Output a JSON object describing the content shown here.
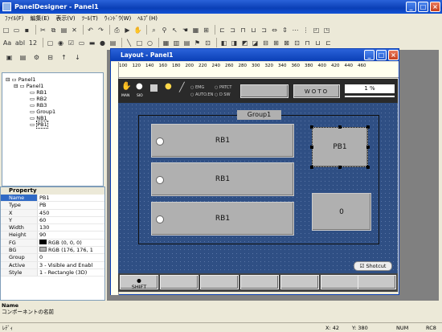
{
  "app": {
    "title": "PanelDesigner - Panel1"
  },
  "menu": [
    "ﾌｧｲﾙ(F)",
    "編集(E)",
    "表示(V)",
    "ﾂｰﾙ(T)",
    "ｳｨﾝﾄﾞｳ(W)",
    "ﾍﾙﾌﾟ(H)"
  ],
  "tree": {
    "root": "Panel1",
    "panel": "Panel1",
    "items": [
      "RB1",
      "RB2",
      "RB3",
      "Group1",
      "NB1",
      "PB1"
    ]
  },
  "props": {
    "header": "Property",
    "rows": [
      {
        "k": "Name",
        "v": "PB1"
      },
      {
        "k": "Type",
        "v": "PB"
      },
      {
        "k": "X",
        "v": "450"
      },
      {
        "k": "Y",
        "v": "60"
      },
      {
        "k": "Width",
        "v": "130"
      },
      {
        "k": "Height",
        "v": "90"
      },
      {
        "k": "FG",
        "v": "RGB (0, 0, 0)"
      },
      {
        "k": "BG",
        "v": "RGB (176, 176, 1"
      },
      {
        "k": "Group",
        "v": "0"
      },
      {
        "k": "Active",
        "v": "3 - Visible and Enabl"
      },
      {
        "k": "Style",
        "v": "1 - Rectangle (3D)"
      }
    ],
    "desc_title": "Name",
    "desc": "コンポーネントの名前"
  },
  "layout": {
    "title": "Layout - Panel1",
    "wotd": "WOTO",
    "percent": "1 %",
    "group": "Group1",
    "rb1": "RB1",
    "rb2": "RB1",
    "rb3": "RB1",
    "pb": "PB1",
    "nb": "0",
    "shotcut": "Shotcut",
    "shift": "SHIFT",
    "icons": {
      "man": "MAN",
      "sio": "SIO",
      "emg": "EMG",
      "autoen": "AUTO.EN",
      "prtct": "PRTCT",
      "dsw": "D SW"
    },
    "ruler": [
      "100",
      "120",
      "140",
      "160",
      "180",
      "200",
      "220",
      "240",
      "260",
      "280",
      "300",
      "320",
      "340",
      "360",
      "380",
      "400",
      "420",
      "440",
      "460"
    ]
  },
  "status": {
    "left": "ﾚﾃﾞｨ",
    "x_label": "X:",
    "x": "42",
    "y_label": "Y:",
    "y": "380",
    "num": "NUM",
    "rc": "RC8"
  }
}
